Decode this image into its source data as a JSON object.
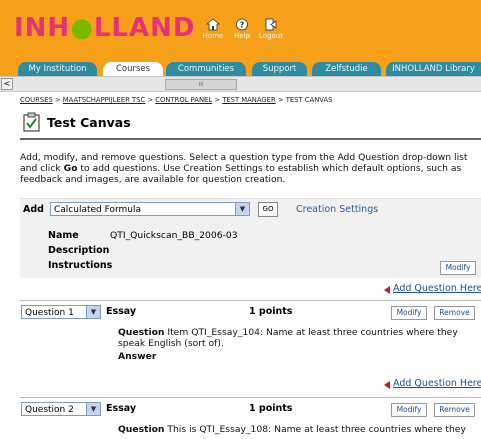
{
  "header": {
    "logo": {
      "part1": "INH",
      "part2": "LLAND"
    },
    "icons": [
      {
        "name": "home-icon",
        "label": "Home"
      },
      {
        "name": "help-icon",
        "label": "Help"
      },
      {
        "name": "logout-icon",
        "label": "Logout"
      }
    ]
  },
  "tabs": [
    "My Institution",
    "Courses",
    "Communities",
    "Support",
    "Zelfstudie",
    "INHOLLAND Library"
  ],
  "active_tab": "Courses",
  "scrollbar": {
    "left_arrow": "<",
    "thumb_grip": "III"
  },
  "breadcrumb": {
    "items": [
      "COURSES",
      "MAATSCHAPPIJLEER TSC",
      "CONTROL PANEL",
      "TEST MANAGER",
      "TEST CANVAS"
    ],
    "separator": ">"
  },
  "page_title": "Test Canvas",
  "intro": {
    "part1": "Add, modify, and remove questions. Select a question type from the Add Question drop-down list and click ",
    "bold": "Go",
    "part2": " to add questions. Use Creation Settings to establish which default options, such as feedback and images, are available for question creation."
  },
  "add_bar": {
    "label": "Add",
    "selected_type": "Calculated Formula",
    "go_label": "GO",
    "creation_settings": "Creation Settings"
  },
  "test_info": {
    "name_label": "Name",
    "name_value": "QTI_Quickscan_BB_2006-03",
    "description_label": "Description",
    "instructions_label": "Instructions",
    "modify_label": "Modify"
  },
  "add_question_label": "Add Question Here",
  "questions": [
    {
      "number_label": "Question 1",
      "type": "Essay",
      "points": "1 points",
      "modify": "Modify",
      "remove": "Remove",
      "question_label": "Question",
      "question_text": " Item QTI_Essay_104: Name at least three countries where they speak English (sort of).",
      "answer_label": "Answer"
    },
    {
      "number_label": "Question 2",
      "type": "Essay",
      "points": "1 points",
      "modify": "Modify",
      "remove": "Remove",
      "question_label": "Question",
      "question_text": " This is QTI_Essay_108: Name at least three countries where they"
    }
  ],
  "colors": {
    "header_orange": "#f7a11a",
    "tab_teal": "#2d8da0",
    "logo_pink": "#e8317b",
    "logo_green": "#7ab800",
    "link_blue": "#1d4f89",
    "arrow_red": "#c41c1c"
  }
}
